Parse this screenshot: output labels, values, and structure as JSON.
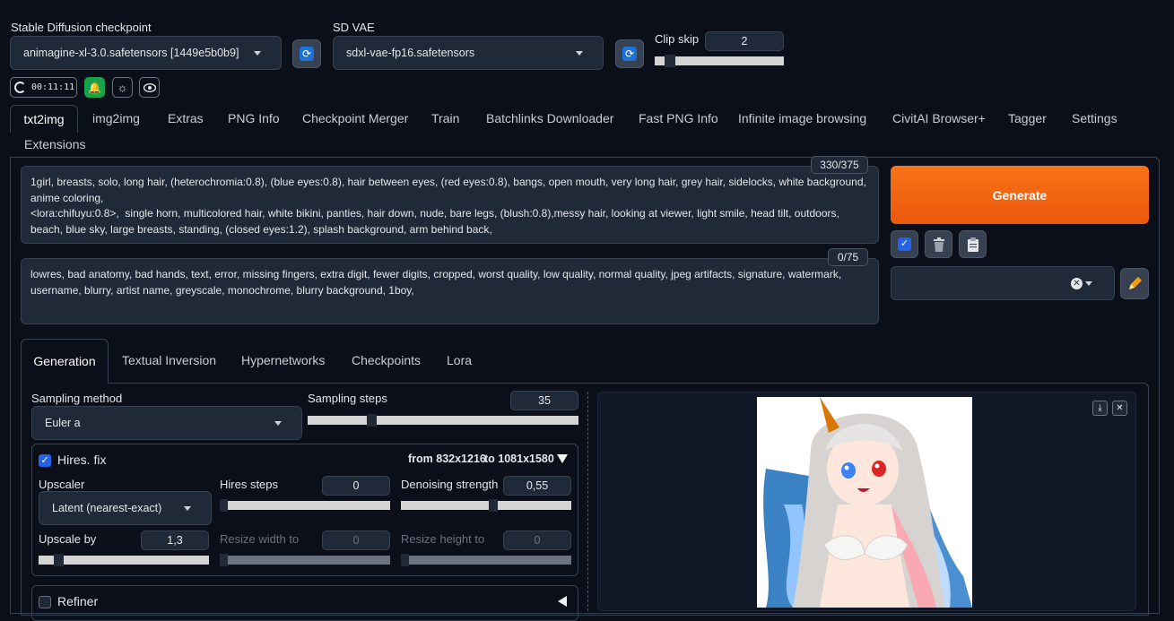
{
  "top": {
    "checkpoint_label": "Stable Diffusion checkpoint",
    "checkpoint_value": "animagine-xl-3.0.safetensors [1449e5b0b9]",
    "vae_label": "SD VAE",
    "vae_value": "sdxl-vae-fp16.safetensors",
    "clip_skip_label": "Clip skip",
    "clip_skip_value": "2",
    "clip_skip_level": 0.08,
    "timer": "00:11:11"
  },
  "tabs": [
    "txt2img",
    "img2img",
    "Extras",
    "PNG Info",
    "Checkpoint Merger",
    "Train",
    "Batchlinks Downloader",
    "Fast PNG Info",
    "Infinite image browsing",
    "CivitAI Browser+",
    "Tagger",
    "Settings",
    "Extensions"
  ],
  "active_tab": "txt2img",
  "prompt": {
    "text": "1girl, breasts, solo, long hair, (heterochromia:0.8), (blue eyes:0.8), hair between eyes, (red eyes:0.8), bangs, open mouth, very long hair, grey hair, sidelocks, white background, anime coloring,\n<lora:chifuyu:0.8>,  single horn, multicolored hair, white bikini, panties, hair down, nude, bare legs, (blush:0.8),messy hair, looking at viewer, light smile, head tilt, outdoors, beach, blue sky, large breasts, standing, (closed eyes:1.2), splash background, arm behind back,",
    "counter": "330/375"
  },
  "negative": {
    "text": "lowres, bad anatomy, bad hands, text, error, missing fingers, extra digit, fewer digits, cropped, worst quality, low quality, normal quality, jpeg artifacts, signature, watermark, username, blurry, artist name, greyscale, monochrome, blurry background, 1boy,",
    "counter": "0/75"
  },
  "generate_label": "Generate",
  "subtabs": [
    "Generation",
    "Textual Inversion",
    "Hypernetworks",
    "Checkpoints",
    "Lora"
  ],
  "sampling": {
    "method_label": "Sampling method",
    "method_value": "Euler a",
    "steps_label": "Sampling steps",
    "steps_value": "35",
    "steps_level": 0.23
  },
  "hires": {
    "label": "Hires. fix",
    "checked": true,
    "summary_from": "from 832x1216",
    "summary_to": "to 1081x1580",
    "upscaler_label": "Upscaler",
    "upscaler_value": "Latent (nearest-exact)",
    "steps_label": "Hires steps",
    "steps_value": "0",
    "denoise_label": "Denoising strength",
    "denoise_value": "0,55",
    "upscale_by_label": "Upscale by",
    "upscale_by_value": "1,3",
    "resize_w_label": "Resize width to",
    "resize_w_value": "0",
    "resize_h_label": "Resize height to",
    "resize_h_value": "0"
  },
  "refiner_label": "Refiner",
  "colors": {
    "generate": "#ea580c",
    "accent": "#2563eb",
    "bg": "#0b0f19"
  }
}
